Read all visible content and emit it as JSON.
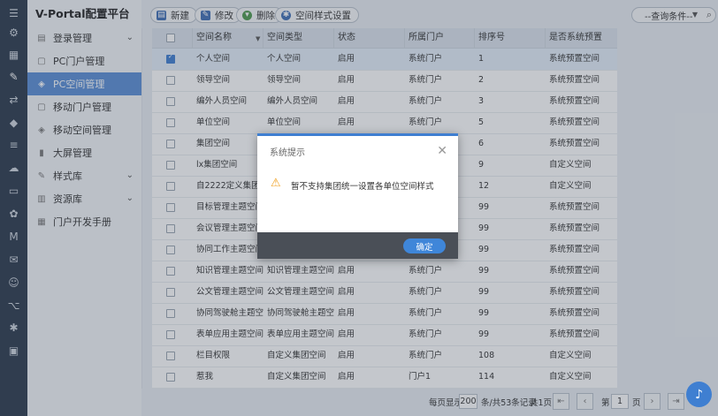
{
  "brand": {
    "title": "V-Portal配置平台"
  },
  "iconbar": [
    {
      "name": "grid-icon",
      "glyph": "☰"
    },
    {
      "name": "org-tree-icon",
      "glyph": "⚙"
    },
    {
      "name": "calendar-icon",
      "glyph": "▦"
    },
    {
      "name": "paint-icon",
      "glyph": "✎"
    },
    {
      "name": "flow-icon",
      "glyph": "⇄"
    },
    {
      "name": "shield-icon",
      "glyph": "◆"
    },
    {
      "name": "stack-icon",
      "glyph": "≡"
    },
    {
      "name": "cloud-icon",
      "glyph": "☁"
    },
    {
      "name": "document-icon",
      "glyph": "▭"
    },
    {
      "name": "apps-icon",
      "glyph": "✿"
    },
    {
      "name": "m-logo-icon",
      "glyph": "M"
    },
    {
      "name": "chat-icon",
      "glyph": "✉"
    },
    {
      "name": "robot-icon",
      "glyph": "☺"
    },
    {
      "name": "code-icon",
      "glyph": "⌥"
    },
    {
      "name": "settings-icon",
      "glyph": "✱"
    },
    {
      "name": "monitor-icon",
      "glyph": "▣"
    }
  ],
  "menu": [
    {
      "label": "登录管理",
      "icon": "login-icon",
      "glyph": "▤",
      "chevron": "⌄",
      "active": false
    },
    {
      "label": "PC门户管理",
      "icon": "pc-portal-icon",
      "glyph": "▢",
      "chevron": "",
      "active": false
    },
    {
      "label": "PC空间管理",
      "icon": "pc-space-icon",
      "glyph": "◈",
      "chevron": "",
      "active": true
    },
    {
      "label": "移动门户管理",
      "icon": "mobile-portal-icon",
      "glyph": "▢",
      "chevron": "",
      "active": false
    },
    {
      "label": "移动空间管理",
      "icon": "mobile-space-icon",
      "glyph": "◈",
      "chevron": "",
      "active": false
    },
    {
      "label": "大屏管理",
      "icon": "big-screen-icon",
      "glyph": "▮",
      "chevron": "",
      "active": false
    },
    {
      "label": "样式库",
      "icon": "style-library-icon",
      "glyph": "✎",
      "chevron": "⌄",
      "active": false
    },
    {
      "label": "资源库",
      "icon": "resource-library-icon",
      "glyph": "▥",
      "chevron": "⌄",
      "active": false
    },
    {
      "label": "门户开发手册",
      "icon": "dev-manual-icon",
      "glyph": "▦",
      "chevron": "",
      "active": false
    }
  ],
  "toolbar": {
    "new_label": "新建",
    "edit_label": "修改",
    "delete_label": "删除",
    "style_label": "空间样式设置",
    "query_label": "--查询条件--"
  },
  "table": {
    "headers": [
      "空间名称",
      "空间类型",
      "状态",
      "所属门户",
      "排序号",
      "是否系统预置"
    ],
    "rows": [
      {
        "checked": true,
        "cells": [
          "个人空间",
          "个人空间",
          "启用",
          "系统门户",
          "1",
          "系统预置空间"
        ]
      },
      {
        "checked": false,
        "cells": [
          "领导空间",
          "领导空间",
          "启用",
          "系统门户",
          "2",
          "系统预置空间"
        ]
      },
      {
        "checked": false,
        "cells": [
          "编外人员空间",
          "编外人员空间",
          "启用",
          "系统门户",
          "3",
          "系统预置空间"
        ]
      },
      {
        "checked": false,
        "cells": [
          "单位空间",
          "单位空间",
          "启用",
          "系统门户",
          "5",
          "系统预置空间"
        ]
      },
      {
        "checked": false,
        "cells": [
          "集团空间",
          "",
          "",
          "",
          "6",
          "系统预置空间"
        ]
      },
      {
        "checked": false,
        "cells": [
          "lx集团空间",
          "",
          "",
          "",
          "9",
          "自定义空间"
        ]
      },
      {
        "checked": false,
        "cells": [
          "自2222定义集团空间",
          "",
          "",
          "",
          "12",
          "自定义空间"
        ]
      },
      {
        "checked": false,
        "cells": [
          "目标管理主题空间",
          "",
          "",
          "",
          "99",
          "系统预置空间"
        ]
      },
      {
        "checked": false,
        "cells": [
          "会议管理主题空间",
          "",
          "",
          "",
          "99",
          "系统预置空间"
        ]
      },
      {
        "checked": false,
        "cells": [
          "协同工作主题空间",
          "",
          "",
          "",
          "99",
          "系统预置空间"
        ]
      },
      {
        "checked": false,
        "cells": [
          "知识管理主题空间",
          "知识管理主题空间",
          "启用",
          "系统门户",
          "99",
          "系统预置空间"
        ]
      },
      {
        "checked": false,
        "cells": [
          "公文管理主题空间",
          "公文管理主题空间",
          "启用",
          "系统门户",
          "99",
          "系统预置空间"
        ]
      },
      {
        "checked": false,
        "cells": [
          "协同驾驶舱主题空间",
          "协同驾驶舱主题空间",
          "启用",
          "系统门户",
          "99",
          "系统预置空间"
        ]
      },
      {
        "checked": false,
        "cells": [
          "表单应用主题空间",
          "表单应用主题空间",
          "启用",
          "系统门户",
          "99",
          "系统预置空间"
        ]
      },
      {
        "checked": false,
        "cells": [
          "栏目权限",
          "自定义集团空间",
          "启用",
          "系统门户",
          "108",
          "自定义空间"
        ]
      },
      {
        "checked": false,
        "cells": [
          "惹我",
          "自定义集团空间",
          "启用",
          "门户1",
          "114",
          "自定义空间"
        ]
      }
    ]
  },
  "pager": {
    "per_page_label": "每页显示",
    "per_page_value": "200",
    "total_label": "条/共53条记录",
    "pages_label": "共1页",
    "page_prefix": "第",
    "page_value": "1",
    "page_suffix": "页"
  },
  "modal": {
    "title": "系统提示",
    "message": "暂不支持集团统一设置各单位空间样式",
    "ok_label": "确定"
  }
}
